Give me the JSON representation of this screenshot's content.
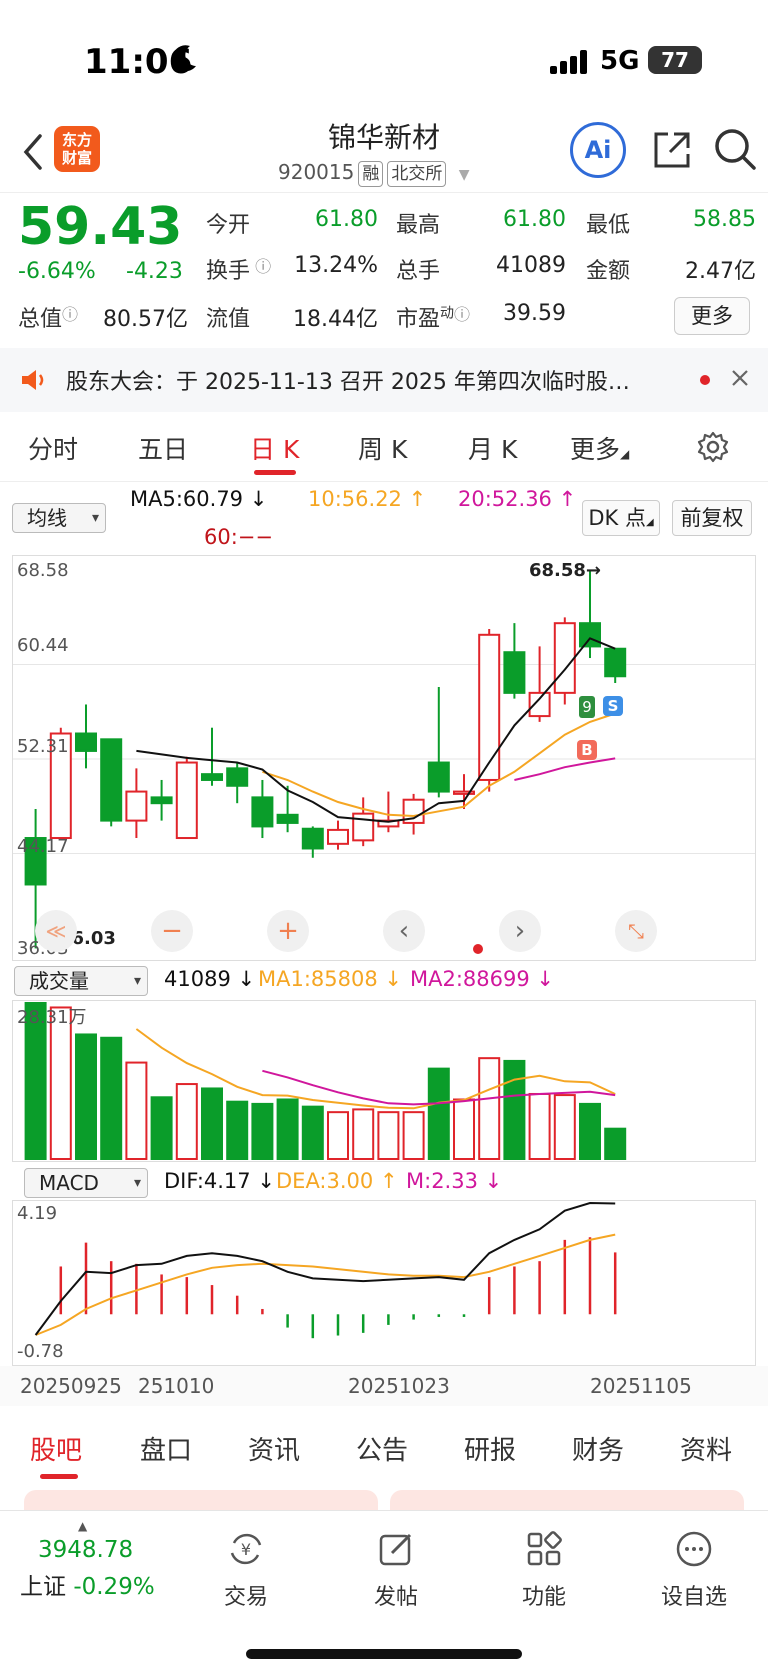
{
  "status": {
    "time": "11:06",
    "network": "5G",
    "battery": "77"
  },
  "header": {
    "logo_line1": "东方",
    "logo_line2": "财富",
    "stock_name": "锦华新材",
    "stock_code": "920015",
    "tag_rong": "融",
    "tag_exchange": "北交所",
    "ai_label": "Ai"
  },
  "quote": {
    "price": "59.43",
    "change_pct": "-6.64%",
    "change": "-4.23",
    "open_label": "今开",
    "open": "61.80",
    "high_label": "最高",
    "high": "61.80",
    "low_label": "最低",
    "low": "58.85",
    "turnover_label": "换手",
    "turnover": "13.24%",
    "volume_label": "总手",
    "volume": "41089",
    "amount_label": "金额",
    "amount": "2.47亿",
    "mcap_label": "总值",
    "mcap": "80.57亿",
    "float_label": "流值",
    "float_mcap": "18.44亿",
    "pe_label": "市盈",
    "pe_sup": "动",
    "pe": "39.59",
    "more_label": "更多"
  },
  "notice": {
    "text": "股东大会：于 2025-11-13 召开 2025 年第四次临时股…"
  },
  "tabs": [
    {
      "label": "分时"
    },
    {
      "label": "五日"
    },
    {
      "label": "日 K"
    },
    {
      "label": "周 K"
    },
    {
      "label": "月 K"
    },
    {
      "label": "更多"
    }
  ],
  "kline_controls": {
    "ma_select": "均线",
    "ma5": "MA5:60.79 ↓",
    "ma10": "10:56.22 ↑",
    "ma20": "20:52.36 ↑",
    "ma60": "60:−−",
    "dk_label": "DK 点",
    "adjust_label": "前复权"
  },
  "price_axis": {
    "top": "68.58",
    "mid1": "60.44",
    "mid2": "52.31",
    "mid3": "44.17",
    "bottom": "36.03"
  },
  "annotations": {
    "high_marker": "68.58→",
    "low_marker": "36.03",
    "buy": "B",
    "sell": "S",
    "nine": "9"
  },
  "volume_panel": {
    "select": "成交量",
    "vol": "41089 ↓",
    "ma1": "MA1:85808 ↓",
    "ma2": "MA2:88699 ↓",
    "top": "28.31万"
  },
  "macd_panel": {
    "select": "MACD",
    "dif": "DIF:4.17 ↓",
    "dea": "DEA:3.00 ↑",
    "m": "M:2.33 ↓",
    "top": "4.19",
    "bottom": "-0.78"
  },
  "dates": {
    "d1": "20250925",
    "d2": "251010",
    "d3": "20251023",
    "d4": "20251105"
  },
  "chart_data": {
    "type": "candlestick",
    "ylim": [
      36.03,
      68.58
    ],
    "candles": [
      {
        "o": 45.5,
        "h": 48.0,
        "l": 36.0,
        "c": 41.5
      },
      {
        "o": 45.5,
        "h": 55.0,
        "l": 45.5,
        "c": 54.5
      },
      {
        "o": 54.5,
        "h": 57.0,
        "l": 51.5,
        "c": 53.0
      },
      {
        "o": 54.0,
        "h": 54.0,
        "l": 46.5,
        "c": 47.0
      },
      {
        "o": 47.0,
        "h": 51.5,
        "l": 45.5,
        "c": 49.5
      },
      {
        "o": 49.0,
        "h": 50.5,
        "l": 47.0,
        "c": 48.5
      },
      {
        "o": 45.5,
        "h": 52.5,
        "l": 45.5,
        "c": 52.0
      },
      {
        "o": 51.0,
        "h": 55.0,
        "l": 50.0,
        "c": 50.5
      },
      {
        "o": 51.5,
        "h": 52.0,
        "l": 48.5,
        "c": 50.0
      },
      {
        "o": 49.0,
        "h": 50.5,
        "l": 45.5,
        "c": 46.5
      },
      {
        "o": 47.5,
        "h": 50.0,
        "l": 46.0,
        "c": 46.8
      },
      {
        "o": 46.3,
        "h": 46.5,
        "l": 43.8,
        "c": 44.6
      },
      {
        "o": 45.0,
        "h": 47.0,
        "l": 44.5,
        "c": 46.2
      },
      {
        "o": 45.3,
        "h": 49.0,
        "l": 44.8,
        "c": 47.6
      },
      {
        "o": 46.5,
        "h": 49.5,
        "l": 46.0,
        "c": 47.0
      },
      {
        "o": 46.8,
        "h": 49.3,
        "l": 45.8,
        "c": 48.8
      },
      {
        "o": 52.0,
        "h": 58.5,
        "l": 49.0,
        "c": 49.5
      },
      {
        "o": 49.3,
        "h": 51.0,
        "l": 48.0,
        "c": 49.5
      },
      {
        "o": 50.5,
        "h": 63.5,
        "l": 49.5,
        "c": 63.0
      },
      {
        "o": 61.5,
        "h": 64.0,
        "l": 57.5,
        "c": 58.0
      },
      {
        "o": 56.0,
        "h": 62.0,
        "l": 55.5,
        "c": 58.0
      },
      {
        "o": 58.0,
        "h": 64.5,
        "l": 57.0,
        "c": 64.0
      },
      {
        "o": 64.0,
        "h": 68.58,
        "l": 61.0,
        "c": 62.0
      },
      {
        "o": 61.8,
        "h": 61.8,
        "l": 58.85,
        "c": 59.43
      }
    ],
    "ma5": [
      null,
      null,
      null,
      null,
      53.0,
      52.7,
      52.4,
      52.2,
      52.0,
      51.4,
      49.6,
      48.6,
      47.3,
      47.1,
      46.9,
      47.2,
      48.5,
      48.7,
      52.0,
      55.2,
      57.5,
      60.0,
      62.7,
      61.8
    ],
    "ma10": [
      null,
      null,
      null,
      null,
      null,
      null,
      null,
      null,
      null,
      51.2,
      50.5,
      49.5,
      48.6,
      48.0,
      47.5,
      47.4,
      47.8,
      48.2,
      50.0,
      51.2,
      52.8,
      54.4,
      55.5,
      56.22
    ],
    "ma20": [
      null,
      null,
      null,
      null,
      null,
      null,
      null,
      null,
      null,
      null,
      null,
      null,
      null,
      null,
      null,
      null,
      null,
      null,
      null,
      50.5,
      51.0,
      51.6,
      52.0,
      52.36
    ],
    "volumes": [
      28.31,
      27.5,
      22.6,
      22.0,
      17.5,
      11.2,
      13.6,
      12.8,
      10.4,
      10.0,
      10.8,
      9.5,
      8.5,
      9.0,
      8.5,
      8.5,
      16.4,
      10.8,
      18.3,
      17.8,
      11.8,
      11.6,
      10.0,
      5.5
    ],
    "vol_ma1": [
      null,
      null,
      null,
      null,
      23.6,
      20.2,
      17.4,
      15.4,
      13.1,
      11.6,
      11.5,
      10.7,
      10.2,
      9.7,
      9.3,
      9.2,
      10.2,
      10.7,
      12.6,
      14.4,
      15.1,
      14.1,
      13.9,
      11.8
    ],
    "vol_ma2": [
      null,
      null,
      null,
      null,
      null,
      null,
      null,
      null,
      null,
      16.0,
      14.8,
      13.4,
      12.1,
      11.0,
      10.1,
      9.9,
      10.1,
      10.5,
      11.0,
      11.5,
      11.8,
      12.0,
      12.2,
      11.6
    ],
    "macd_dif": [
      -0.78,
      0.5,
      1.6,
      1.55,
      1.85,
      1.9,
      2.2,
      2.3,
      2.2,
      2.0,
      1.6,
      1.35,
      1.3,
      1.25,
      1.3,
      1.35,
      1.4,
      1.3,
      2.3,
      2.8,
      3.2,
      3.9,
      4.19,
      4.17
    ],
    "macd_dea": [
      -0.78,
      -0.4,
      0.2,
      0.6,
      0.9,
      1.2,
      1.5,
      1.75,
      1.85,
      1.9,
      1.85,
      1.8,
      1.7,
      1.6,
      1.5,
      1.45,
      1.45,
      1.4,
      1.6,
      1.9,
      2.2,
      2.5,
      2.8,
      3.0
    ],
    "macd_m": [
      null,
      1.8,
      2.7,
      2.0,
      1.9,
      1.5,
      1.4,
      1.1,
      0.7,
      0.2,
      -0.5,
      -0.9,
      -0.8,
      -0.7,
      -0.4,
      -0.2,
      -0.1,
      -0.1,
      1.4,
      1.8,
      2.0,
      2.8,
      2.9,
      2.33
    ]
  },
  "sub_tabs": [
    {
      "label": "股吧"
    },
    {
      "label": "盘口"
    },
    {
      "label": "资讯"
    },
    {
      "label": "公告"
    },
    {
      "label": "研报"
    },
    {
      "label": "财务"
    },
    {
      "label": "资料"
    }
  ],
  "bottom_bar": {
    "index_value": "3948.78",
    "index_name": "上证",
    "index_change": "-0.29%",
    "trade": "交易",
    "post": "发帖",
    "function": "功能",
    "watchlist": "设自选"
  },
  "colors": {
    "up": "#e0242a",
    "down": "#0a9d2a",
    "ma5": "#111111",
    "ma10": "#f5a623",
    "ma20": "#d0179c"
  }
}
